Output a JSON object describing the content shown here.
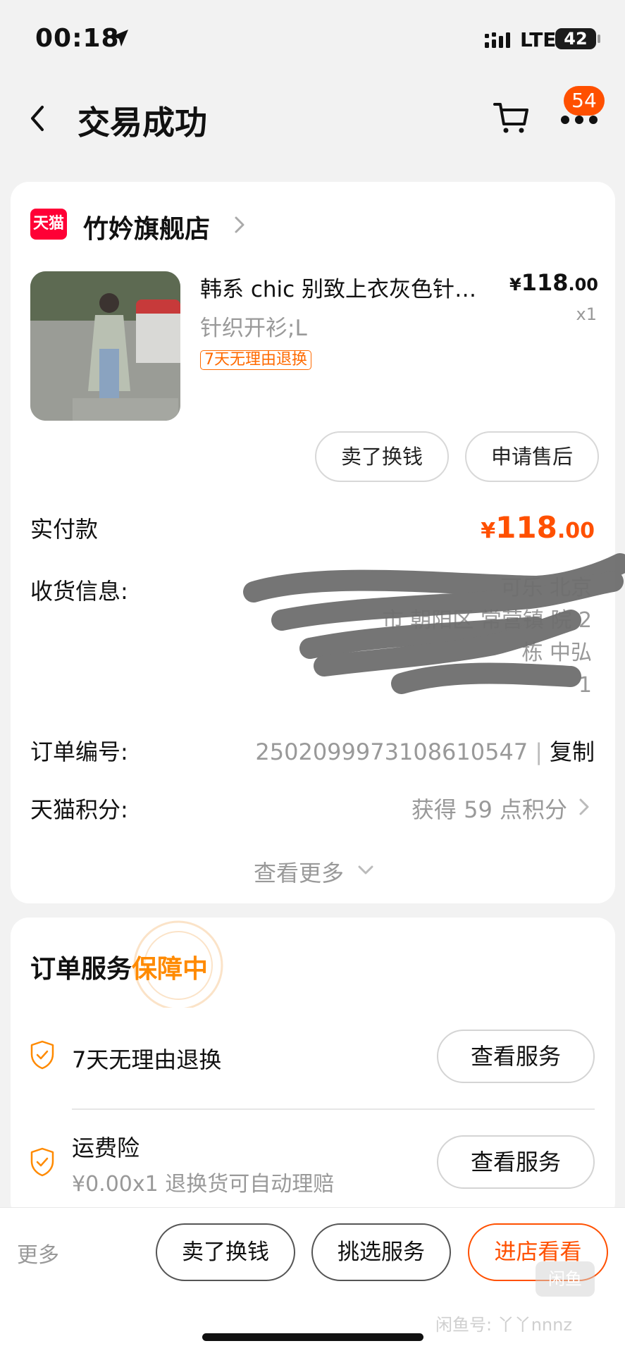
{
  "status_bar": {
    "time": "00:18",
    "network": "LTE",
    "battery": "42"
  },
  "header": {
    "title": "交易成功",
    "cart_badge": "54"
  },
  "shop": {
    "logo_text": "天猫",
    "name": "竹妗旗舰店"
  },
  "product": {
    "title": "韩系 chic 别致上衣灰色针织开衫",
    "sku": "针织开衫;L",
    "price_symbol": "¥",
    "price_int": "118",
    "price_dec": ".00",
    "qty": "x1",
    "tag": "7天无理由退换"
  },
  "item_actions": {
    "sell": "卖了换钱",
    "after_sale": "申请售后"
  },
  "payment": {
    "label": "实付款",
    "symbol": "¥",
    "amount_int": "118",
    "amount_dec": ".00"
  },
  "delivery": {
    "label": "收货信息:",
    "lines": [
      "可乐 北京",
      "市 朝阳区 常营镇 院 2",
      "栋 中弘",
      "1"
    ]
  },
  "order": {
    "label": "订单编号:",
    "number": "2502099973108610547",
    "separator": "|",
    "copy": "复制"
  },
  "points": {
    "label": "天猫积分:",
    "value": "获得 59 点积分"
  },
  "view_more": "查看更多",
  "services": {
    "title": "订单服务",
    "title_highlight": "保障中",
    "items": [
      {
        "name": "7天无理由退换",
        "desc": "",
        "button": "查看服务"
      },
      {
        "name": "运费险",
        "desc": "¥0.00x1 退换货可自动理赔",
        "button": "查看服务"
      }
    ]
  },
  "bottom_bar": {
    "more": "更多",
    "sell": "卖了换钱",
    "pick_service": "挑选服务",
    "visit_store": "进店看看"
  },
  "watermark": {
    "logo": "闲鱼",
    "text": "闲鱼号: 丫丫nnnz"
  },
  "colors": {
    "accent": "#ff5000",
    "highlight": "#ff8a00",
    "tmall_red": "#ff0036"
  }
}
